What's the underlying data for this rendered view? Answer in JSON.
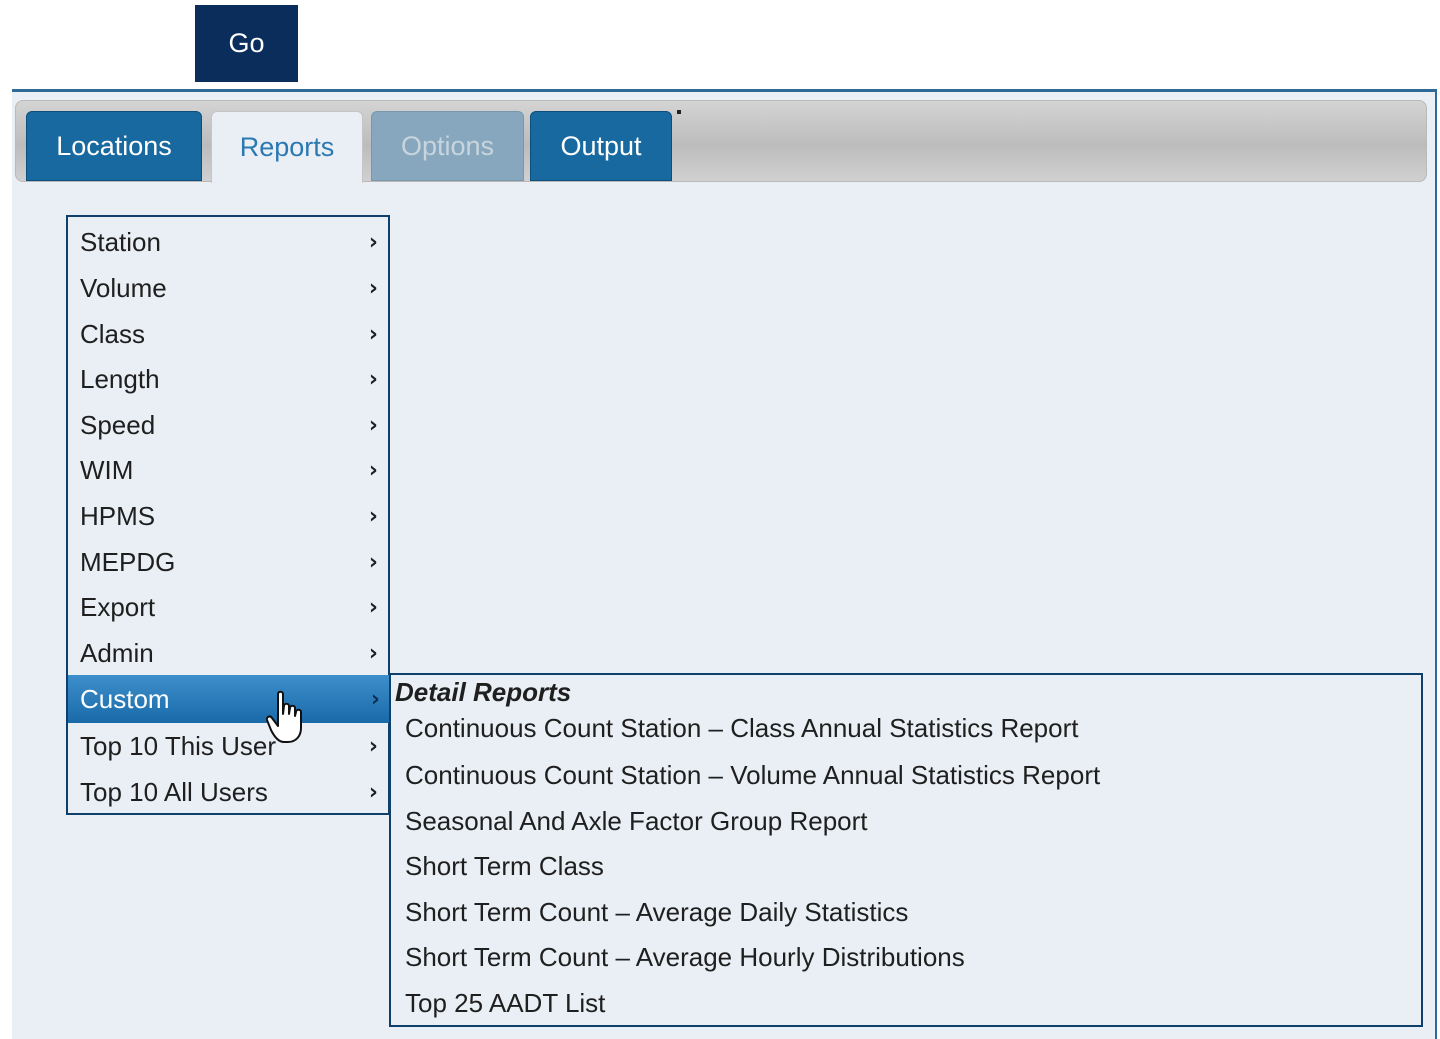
{
  "go_button": {
    "label": "Go"
  },
  "tabs": [
    {
      "label": "Locations",
      "state": "normal"
    },
    {
      "label": "Reports",
      "state": "active"
    },
    {
      "label": "Options",
      "state": "disabled"
    },
    {
      "label": "Output",
      "state": "normal"
    }
  ],
  "reports_menu": {
    "items": [
      {
        "label": "Station",
        "chevron": "›"
      },
      {
        "label": "Volume",
        "chevron": "›"
      },
      {
        "label": "Class",
        "chevron": "›"
      },
      {
        "label": "Length",
        "chevron": "›"
      },
      {
        "label": "Speed",
        "chevron": "›"
      },
      {
        "label": "WIM",
        "chevron": "›"
      },
      {
        "label": "HPMS",
        "chevron": "›"
      },
      {
        "label": "MEPDG",
        "chevron": "›"
      },
      {
        "label": "Export",
        "chevron": "›"
      },
      {
        "label": "Admin",
        "chevron": "›"
      },
      {
        "label": "Custom",
        "chevron": "›",
        "active": true
      },
      {
        "label": "Top 10 This User",
        "chevron": "›"
      },
      {
        "label": "Top 10 All Users",
        "chevron": "›"
      }
    ]
  },
  "custom_submenu": {
    "header": "Detail Reports",
    "items": [
      "Continuous Count Station – Class Annual Statistics Report",
      "Continuous Count Station – Volume Annual Statistics Report",
      "Seasonal And Axle Factor Group Report",
      "Short Term Class",
      "Short Term Count – Average Daily Statistics",
      "Short Term Count – Average Hourly Distributions",
      "Top 25 AADT List"
    ]
  },
  "icons": {
    "cursor": "hand-pointer-icon",
    "chevron": "chevron-right-icon"
  },
  "colors": {
    "dark_tab": "#17699f",
    "go_button": "#0b2d5c",
    "menu_border": "#0f3f6b",
    "panel_bg": "#e9eff4"
  }
}
